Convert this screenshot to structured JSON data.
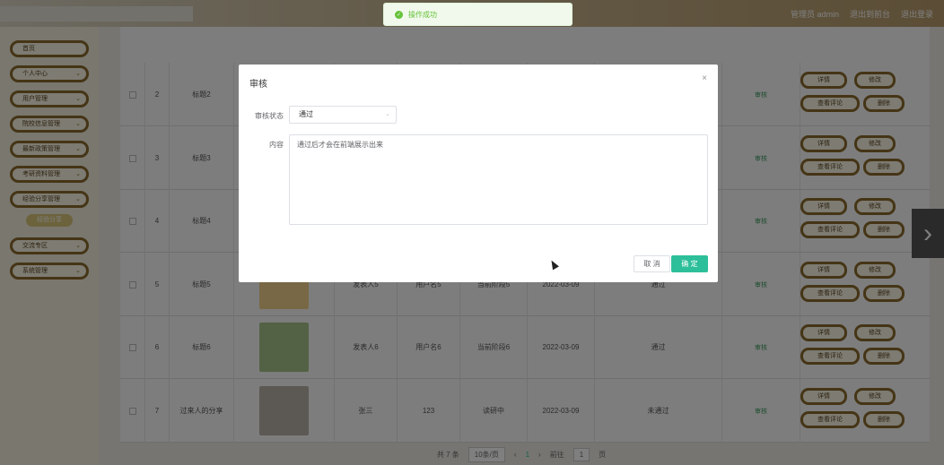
{
  "header": {
    "links": [
      "管理员 admin",
      "退出到前台",
      "退出登录"
    ]
  },
  "sidebar": {
    "items": [
      "首页",
      "个人中心",
      "用户管理",
      "院校信息管理",
      "最新政策管理",
      "考研资料管理",
      "经验分享管理",
      "经验分享",
      "交流专区",
      "系统管理"
    ]
  },
  "table": {
    "rows": [
      {
        "num": "2",
        "title": "标题2",
        "author": "",
        "user": "",
        "stage": "",
        "date": "",
        "status": "",
        "tag": "审核"
      },
      {
        "num": "3",
        "title": "标题3",
        "author": "",
        "user": "",
        "stage": "",
        "date": "",
        "status": "",
        "tag": "审核"
      },
      {
        "num": "4",
        "title": "标题4",
        "author": "",
        "user": "",
        "stage": "",
        "date": "",
        "status": "",
        "tag": "审核"
      },
      {
        "num": "5",
        "title": "标题5",
        "author": "发表人5",
        "user": "用户名5",
        "stage": "当前阶段5",
        "date": "2022-03-09",
        "status": "通过",
        "tag": "审核"
      },
      {
        "num": "6",
        "title": "标题6",
        "author": "发表人6",
        "user": "用户名6",
        "stage": "当前阶段6",
        "date": "2022-03-09",
        "status": "通过",
        "tag": "审核"
      },
      {
        "num": "7",
        "title": "过来人的分享",
        "author": "张三",
        "user": "123",
        "stage": "读研中",
        "date": "2022-03-09",
        "status": "未通过",
        "tag": "审核"
      }
    ],
    "ops": {
      "detail": "详情",
      "edit": "修改",
      "comments": "查看评论",
      "delete": "删除"
    }
  },
  "pager": {
    "total": "共 7 条",
    "size": "10条/页",
    "page": "1",
    "goto_label": "前往",
    "goto_value": "1",
    "page_suffix": "页"
  },
  "toast": {
    "text": "操作成功"
  },
  "dialog": {
    "title": "审核",
    "status_label": "审核状态",
    "status_value": "通过",
    "content_label": "内容",
    "content_value": "通过后才会在前端展示出来",
    "cancel": "取 消",
    "confirm": "确 定"
  },
  "colors": {
    "accent": "#2dbf9a",
    "brand": "#8b6a2c",
    "success": "#67c23a"
  }
}
